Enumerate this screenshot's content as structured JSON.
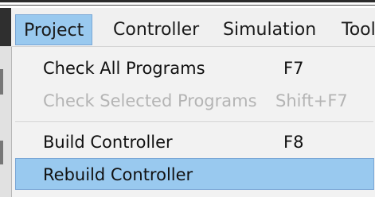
{
  "menubar": {
    "items": [
      {
        "label": "Project",
        "active": true
      },
      {
        "label": "Controller"
      },
      {
        "label": "Simulation"
      },
      {
        "label": "Tool"
      }
    ]
  },
  "dropdown": {
    "items": [
      {
        "label": "Check All Programs",
        "shortcut": "F7",
        "enabled": true
      },
      {
        "label": "Check Selected Programs",
        "shortcut": "Shift+F7",
        "enabled": false
      },
      {
        "label": "Build Controller",
        "shortcut": "F8",
        "enabled": true
      },
      {
        "label": "Rebuild Controller",
        "shortcut": "",
        "enabled": true,
        "highlighted": true
      }
    ]
  },
  "colors": {
    "highlight": "#99c9ef",
    "disabled_text": "#b4b4b4",
    "menu_bg": "#f2f2f2"
  }
}
